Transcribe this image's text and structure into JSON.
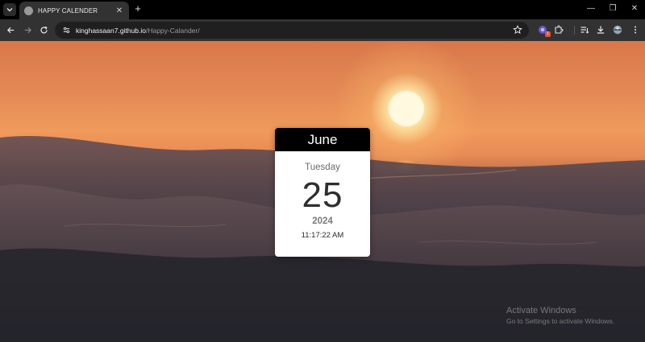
{
  "browser": {
    "tab": {
      "title": "HAPPY CALENDER",
      "close": "✕"
    },
    "new_tab": "+",
    "window_controls": {
      "minimize": "—",
      "restore": "❐",
      "close": "✕"
    },
    "url": {
      "host": "kinghassaan7.github.io",
      "path": "/Happy-Calander/"
    },
    "extension_badge": "1",
    "icons": [
      "tab-search-icon",
      "back-icon",
      "forward-icon",
      "reload-icon",
      "site-info-icon",
      "bookmark-star-icon",
      "extension-profile-icon",
      "extensions-puzzle-icon",
      "reading-list-icon",
      "download-icon",
      "profile-avatar-icon",
      "menu-kebab-icon"
    ]
  },
  "calendar": {
    "month": "June",
    "day": "Tuesday",
    "date": "25",
    "year": "2024",
    "time": "11:17:22 AM"
  },
  "watermark": {
    "title": "Activate Windows",
    "subtitle": "Go to Settings to activate Windows."
  },
  "colors": {
    "browser_bg": "#000000",
    "toolbar_bg": "#323232",
    "omnibox_bg": "#1f1f1f",
    "calendar_header": "#000000",
    "calendar_body": "#ffffff",
    "sky_orange": "#f09a5c",
    "sea_dark": "#2c2a30"
  }
}
